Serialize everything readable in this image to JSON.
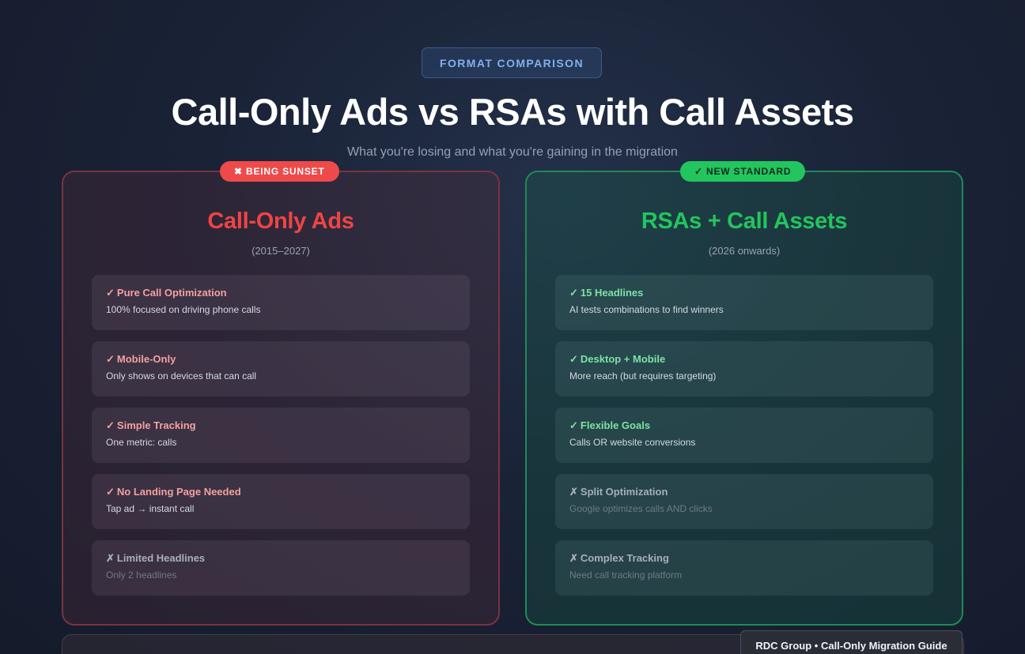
{
  "header": {
    "eyebrow": "FORMAT COMPARISON",
    "title": "Call-Only Ads vs RSAs with Call Assets",
    "subtitle": "What you're losing and what you're gaining in the migration"
  },
  "old_format": {
    "badge": "✖ BEING SUNSET",
    "title": "Call-Only Ads",
    "years": "(2015–2027)",
    "items": [
      {
        "mark": "✓",
        "title": "Pure Call Optimization",
        "desc": "100% focused on driving phone calls"
      },
      {
        "mark": "✓",
        "title": "Mobile-Only",
        "desc": "Only shows on devices that can call"
      },
      {
        "mark": "✓",
        "title": "Simple Tracking",
        "desc": "One metric: calls"
      },
      {
        "mark": "✓",
        "title": "No Landing Page Needed",
        "desc": "Tap ad → instant call"
      },
      {
        "mark": "✗",
        "title": "Limited Headlines",
        "desc": "Only 2 headlines"
      }
    ]
  },
  "new_format": {
    "badge": "✓ NEW STANDARD",
    "title": "RSAs + Call Assets",
    "years": "(2026 onwards)",
    "items": [
      {
        "mark": "✓",
        "title": "15 Headlines",
        "desc": "AI tests combinations to find winners"
      },
      {
        "mark": "✓",
        "title": "Desktop + Mobile",
        "desc": "More reach (but requires targeting)"
      },
      {
        "mark": "✓",
        "title": "Flexible Goals",
        "desc": "Calls OR website conversions"
      },
      {
        "mark": "✗",
        "title": "Split Optimization",
        "desc": "Google optimizes calls AND clicks"
      },
      {
        "mark": "✗",
        "title": "Complex Tracking",
        "desc": "Need call tracking platform"
      }
    ]
  },
  "footer": {
    "label": "RDC Group • Call-Only Migration Guide"
  },
  "colors": {
    "old_accent": "#ef4444",
    "new_accent": "#22c55e",
    "eyebrow_text": "#7fb0f0"
  }
}
